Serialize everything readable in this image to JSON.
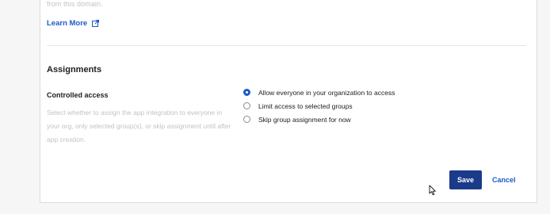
{
  "top_section": {
    "faded_text": "from this domain.",
    "learn_more_label": "Learn More"
  },
  "assignments": {
    "title": "Assignments",
    "controlled_access": {
      "label": "Controlled access",
      "help": "Select whether to assign the app integration to everyone in your org, only selected group(s), or skip assignment until after app creation.",
      "options": [
        {
          "label": "Allow everyone in your organization to access",
          "checked": true
        },
        {
          "label": "Limit access to selected groups",
          "checked": false
        },
        {
          "label": "Skip group assignment for now",
          "checked": false
        }
      ]
    }
  },
  "actions": {
    "save_label": "Save",
    "cancel_label": "Cancel"
  },
  "colors": {
    "primary": "#1b3a8a",
    "link": "#1a5bc8"
  }
}
